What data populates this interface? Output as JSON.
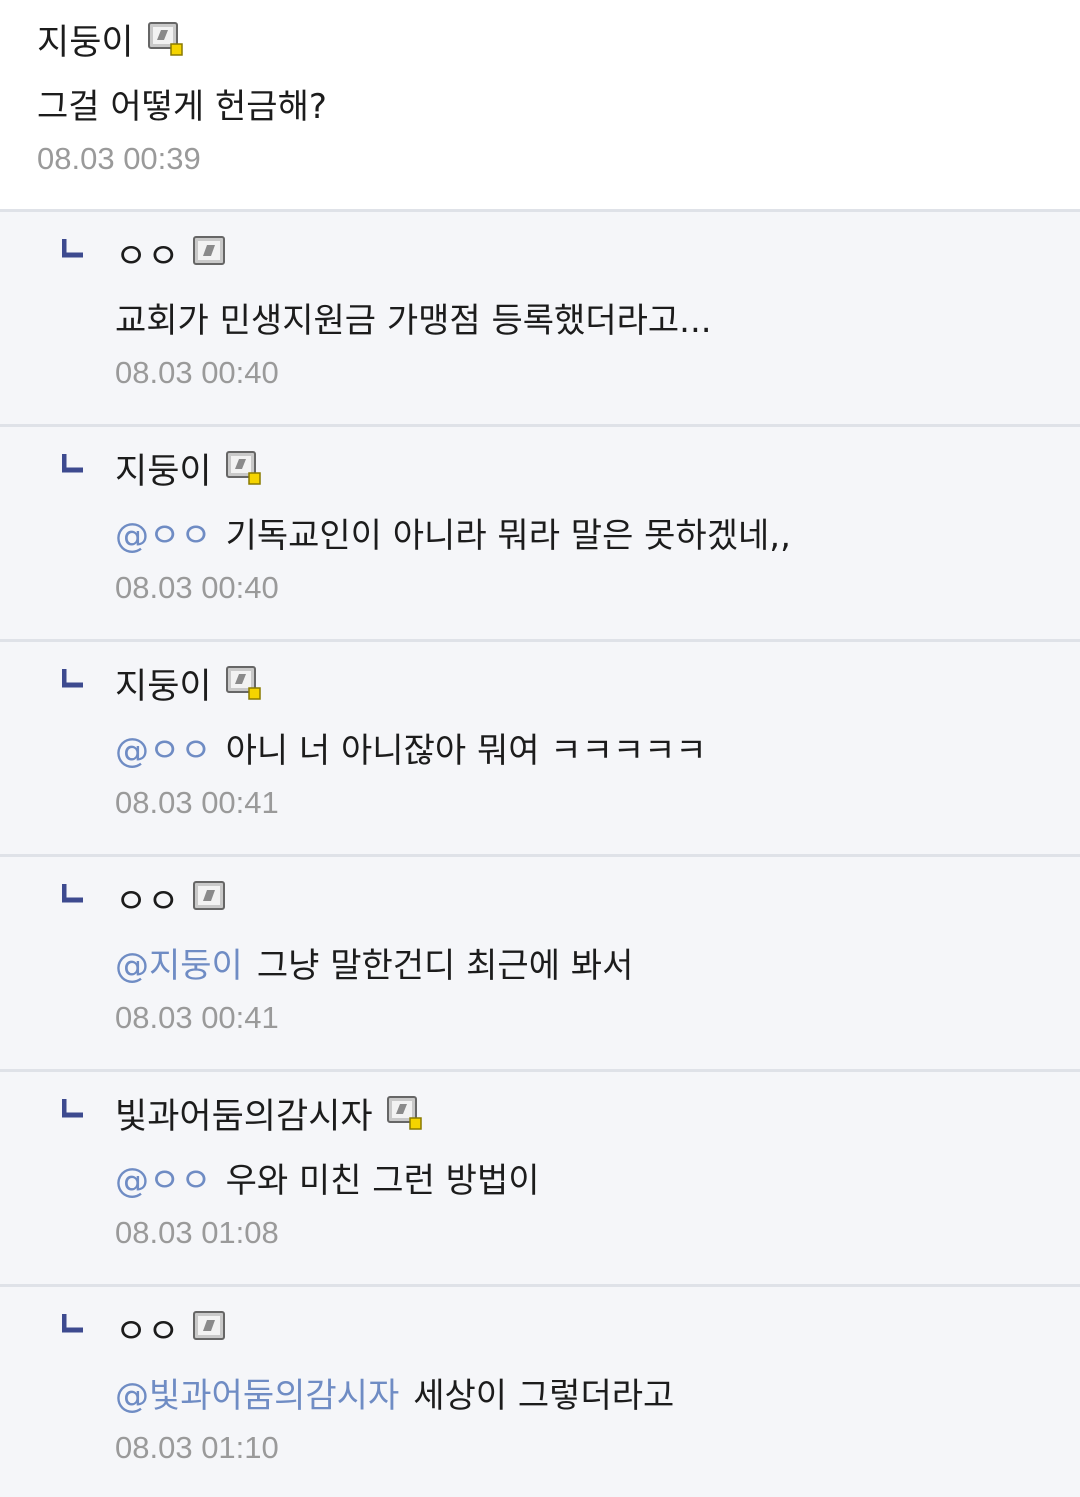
{
  "main_comment": {
    "author": "지둥이",
    "text": "그걸 어떻게 헌금해?",
    "time": "08.03 00:39",
    "icon": "fixed-user-icon-yellow"
  },
  "replies": [
    {
      "author": "ㅇㅇ",
      "icon": "guest-user-icon",
      "mention": "",
      "text": "교회가 민생지원금 가맹점 등록했더라고...",
      "time": "08.03 00:40"
    },
    {
      "author": "지둥이",
      "icon": "fixed-user-icon-yellow",
      "mention": "@ㅇㅇ",
      "text": "기독교인이 아니라 뭐라 말은 못하겠네,,",
      "time": "08.03 00:40"
    },
    {
      "author": "지둥이",
      "icon": "fixed-user-icon-yellow",
      "mention": "@ㅇㅇ",
      "text": "아니 너 아니잖아 뭐여 ㅋㅋㅋㅋㅋ",
      "time": "08.03 00:41"
    },
    {
      "author": "ㅇㅇ",
      "icon": "guest-user-icon",
      "mention": "@지둥이",
      "text": "그냥 말한건디 최근에 봐서",
      "time": "08.03 00:41"
    },
    {
      "author": "빛과어둠의감시자",
      "icon": "fixed-user-icon-yellow",
      "mention": "@ㅇㅇ",
      "text": "우와 미친 그런 방법이",
      "time": "08.03 01:08"
    },
    {
      "author": "ㅇㅇ",
      "icon": "guest-user-icon",
      "mention": "@빛과어둠의감시자",
      "text": "세상이 그렇더라고",
      "time": "08.03 01:10"
    }
  ],
  "colors": {
    "mention": "#6f8cc4",
    "reply_marker": "#3d4a8f",
    "reply_background": "#f5f6f9",
    "divider": "#dfe2e8",
    "timestamp": "#9a9a9a"
  }
}
